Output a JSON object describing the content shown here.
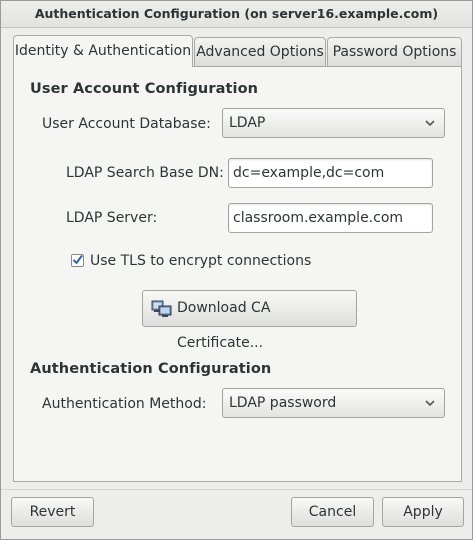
{
  "window": {
    "title": "Authentication Configuration (on server16.example.com)"
  },
  "tabs": [
    {
      "label": "Identity & Authentication",
      "active": true
    },
    {
      "label": "Advanced Options",
      "active": false
    },
    {
      "label": "Password Options",
      "active": false
    }
  ],
  "user_account": {
    "heading": "User Account Configuration",
    "database_label": "User Account Database:",
    "database_value": "LDAP",
    "base_dn_label": "LDAP Search Base DN:",
    "base_dn_value": "dc=example,dc=com",
    "server_label": "LDAP Server:",
    "server_value": "classroom.example.com",
    "tls_label": "Use TLS to encrypt connections",
    "tls_checked": true,
    "download_button": "Download CA Certificate..."
  },
  "authentication": {
    "heading": "Authentication Configuration",
    "method_label": "Authentication Method:",
    "method_value": "LDAP password"
  },
  "footer": {
    "revert": "Revert",
    "cancel": "Cancel",
    "apply": "Apply"
  },
  "colors": {
    "background": "#ededec",
    "panel": "#f5f5f4",
    "check_accent": "#3465a4"
  },
  "icons": {
    "combo_arrow": "chevron-down-icon",
    "download": "network-computer-icon",
    "checkbox": "check-icon"
  }
}
